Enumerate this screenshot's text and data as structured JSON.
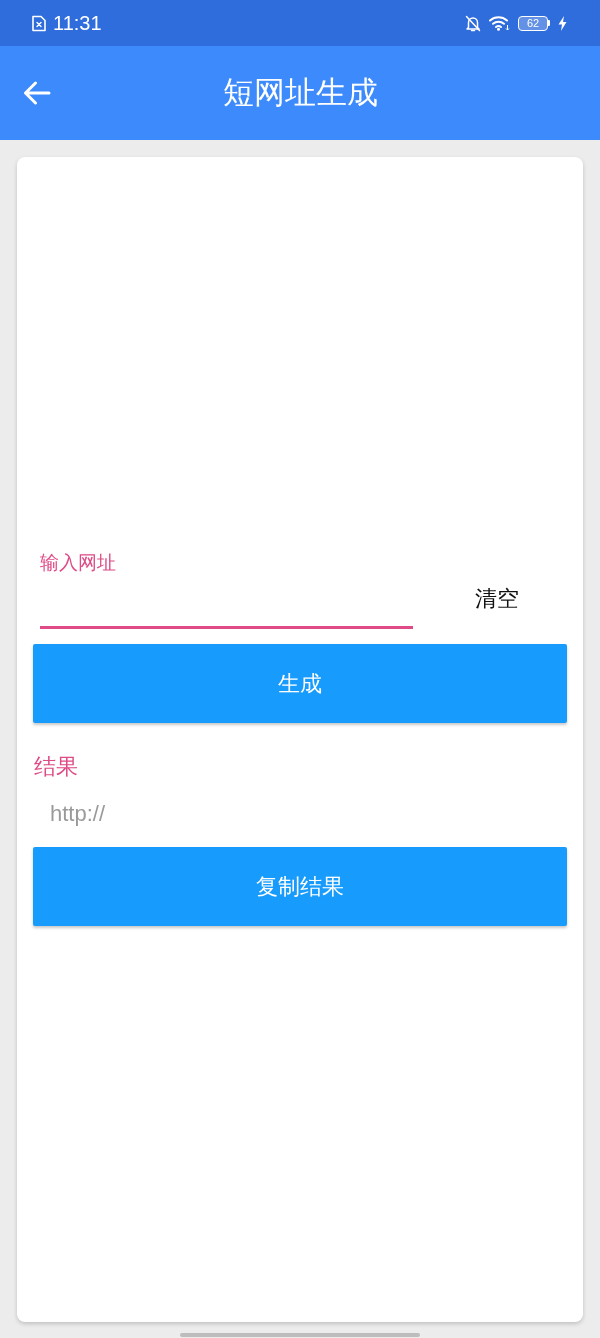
{
  "status_bar": {
    "time": "11:31",
    "battery_text": "62",
    "charging": true
  },
  "app_bar": {
    "title": "短网址生成"
  },
  "url_input": {
    "label": "输入网址",
    "focused": true
  },
  "clear_button": {
    "label": "清空"
  },
  "generate_button": {
    "label": "生成"
  },
  "result": {
    "label": "结果",
    "placeholder": "http://"
  },
  "copy_button": {
    "label": "复制结果"
  }
}
